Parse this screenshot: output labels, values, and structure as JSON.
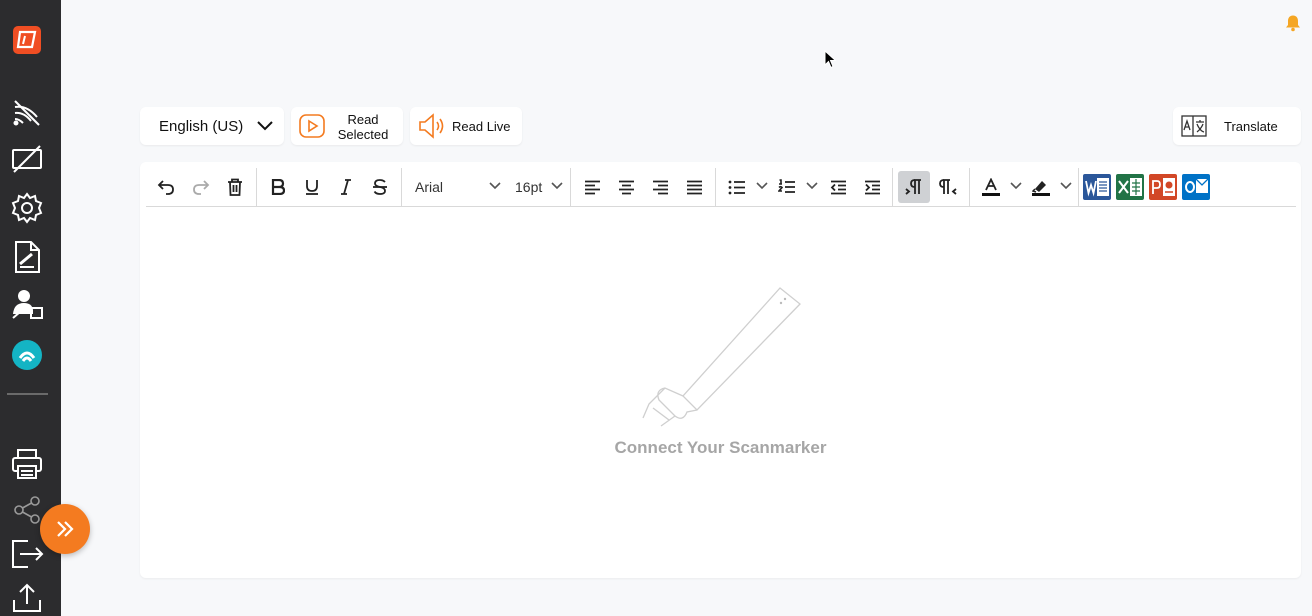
{
  "topbar": {
    "language": "English (US)",
    "read_selected_label": "Read\nSelected",
    "read_live_label": "Read Live",
    "translate_label": "Translate"
  },
  "editor": {
    "font_family": "Arial",
    "font_size": "16pt",
    "empty_message": "Connect Your Scanmarker"
  },
  "colors": {
    "accent": "#f47b20",
    "sidebar": "#2c2c2e",
    "brand": "#f04e23",
    "teal": "#14b4c4"
  }
}
